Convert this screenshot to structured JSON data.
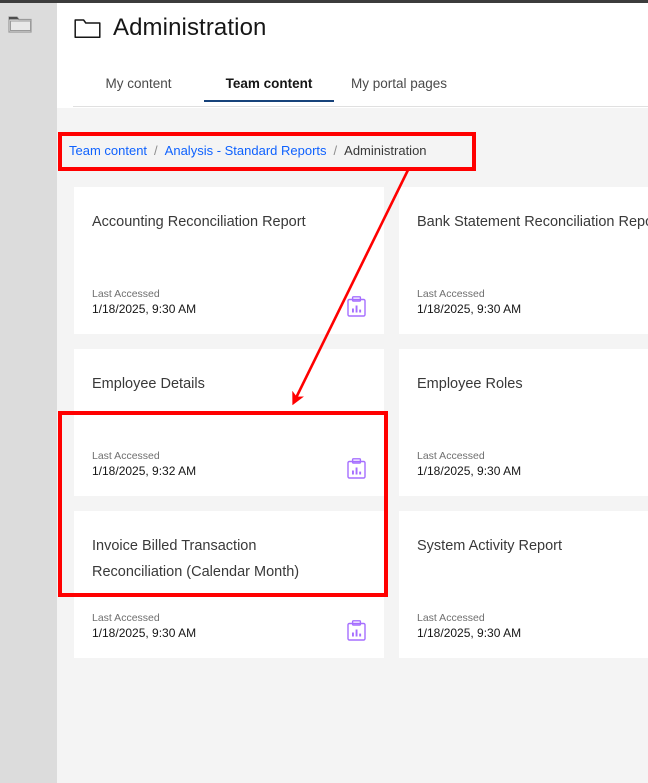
{
  "window": {
    "desktop_icon": "folder-icon"
  },
  "header": {
    "icon": "folder-icon",
    "title": "Administration"
  },
  "tabs": [
    {
      "label": "My content",
      "active": false
    },
    {
      "label": "Team content",
      "active": true
    },
    {
      "label": "My portal pages",
      "active": false
    }
  ],
  "breadcrumb": {
    "separator": "/",
    "items": [
      {
        "label": "Team content",
        "link": true
      },
      {
        "label": "Analysis - Standard Reports",
        "link": true
      },
      {
        "label": "Administration",
        "link": false
      }
    ]
  },
  "cards": [
    {
      "title": "Accounting Reconciliation Report",
      "meta_label": "Last Accessed",
      "meta_value": "1/18/2025, 9:30 AM",
      "icon": "report-clipboard-icon",
      "has_icon": true,
      "highlighted": false
    },
    {
      "title": "Bank Statement Reconciliation Report",
      "meta_label": "Last Accessed",
      "meta_value": "1/18/2025, 9:30 AM",
      "icon": "report-clipboard-icon",
      "has_icon": false,
      "highlighted": false
    },
    {
      "title": "Employee Details",
      "meta_label": "Last Accessed",
      "meta_value": "1/18/2025, 9:32 AM",
      "icon": "report-clipboard-icon",
      "has_icon": true,
      "highlighted": true
    },
    {
      "title": "Employee Roles",
      "meta_label": "Last Accessed",
      "meta_value": "1/18/2025, 9:30 AM",
      "icon": "report-clipboard-icon",
      "has_icon": false,
      "highlighted": false
    },
    {
      "title": "Invoice Billed Transaction Reconciliation (Calendar Month)",
      "meta_label": "Last Accessed",
      "meta_value": "1/18/2025, 9:30 AM",
      "icon": "report-clipboard-icon",
      "has_icon": true,
      "highlighted": false
    },
    {
      "title": "System Activity Report",
      "meta_label": "Last Accessed",
      "meta_value": "1/18/2025, 9:30 AM",
      "icon": "report-clipboard-icon",
      "has_icon": false,
      "highlighted": false
    }
  ],
  "annotations": {
    "color": "#ff0000",
    "boxes": [
      {
        "target": "breadcrumb"
      },
      {
        "target": "employee-details-card"
      }
    ],
    "arrow": {
      "from": "breadcrumb-box",
      "to": "employee-details-card"
    }
  },
  "colors": {
    "accent_tab": "#16427a",
    "link": "#0f62fe",
    "card_icon": "#a56eff",
    "annotation": "#ff0000",
    "page_bg": "#f4f4f4"
  }
}
